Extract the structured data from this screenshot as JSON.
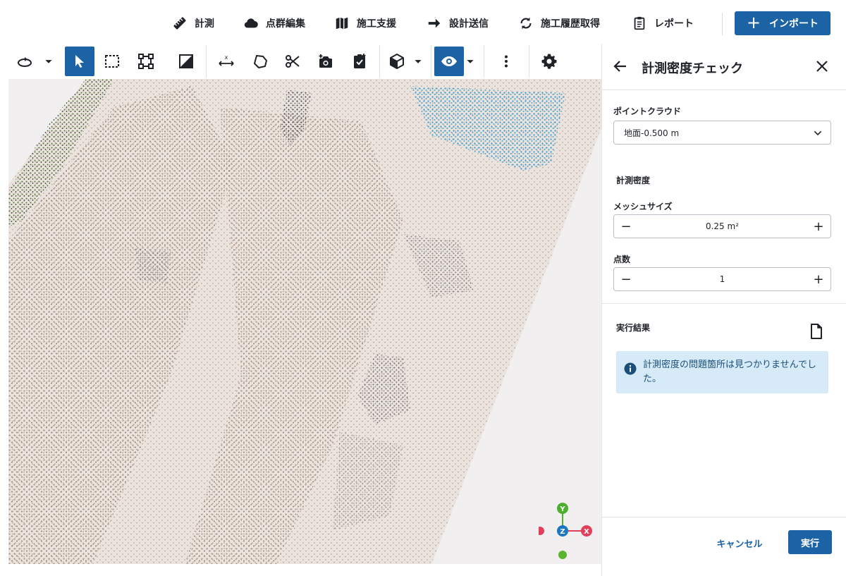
{
  "top_menu": {
    "items": [
      {
        "label": "計測",
        "icon": "ruler-icon"
      },
      {
        "label": "点群編集",
        "icon": "cloud-icon"
      },
      {
        "label": "施工支援",
        "icon": "map-icon"
      },
      {
        "label": "設計送信",
        "icon": "arrow-right-icon"
      },
      {
        "label": "施工履歴取得",
        "icon": "sync-icon"
      },
      {
        "label": "レポート",
        "icon": "clipboard-icon"
      }
    ],
    "import_label": "インポート",
    "import_plus": "+"
  },
  "toolbar": {
    "tools": [
      "rotate-icon",
      "dropdown-arrow-icon",
      "cursor-icon",
      "rectangle-select-icon",
      "box-select-icon",
      "gradient-icon",
      "axis-move-icon",
      "lasso-icon",
      "scissors-icon",
      "add-camera-icon",
      "clipboard-check-icon",
      "cube-icon",
      "dropdown-arrow-icon",
      "eye-icon",
      "dropdown-arrow-icon",
      "more-vert-icon",
      "gear-icon"
    ],
    "active_tool": "cursor-icon",
    "axis_label": "x"
  },
  "viewport": {
    "axis_labels": {
      "y": "Y",
      "z": "Z",
      "x": "X"
    },
    "colors": {
      "y": "#4caf2d",
      "z": "#1a78c2",
      "x": "#e33e5a",
      "neg": "#e33e5a",
      "neg_green": "#5ab52e"
    }
  },
  "panel": {
    "title": "計測密度チェック",
    "point_cloud_label": "ポイントクラウド",
    "point_cloud_value": "地面-0.500 m",
    "density_section": "計測密度",
    "mesh_size_label": "メッシュサイズ",
    "mesh_size_value": "0.25 m²",
    "point_count_label": "点数",
    "point_count_value": "1",
    "minus": "−",
    "plus": "+",
    "result_label": "実行結果",
    "result_message": "計測密度の問題箇所は見つかりませんでした。",
    "cancel_label": "キャンセル",
    "run_label": "実行"
  },
  "colors": {
    "accent": "#1b63a5",
    "info_bg": "#d6eaf7",
    "info_text": "#1b4f7a"
  }
}
